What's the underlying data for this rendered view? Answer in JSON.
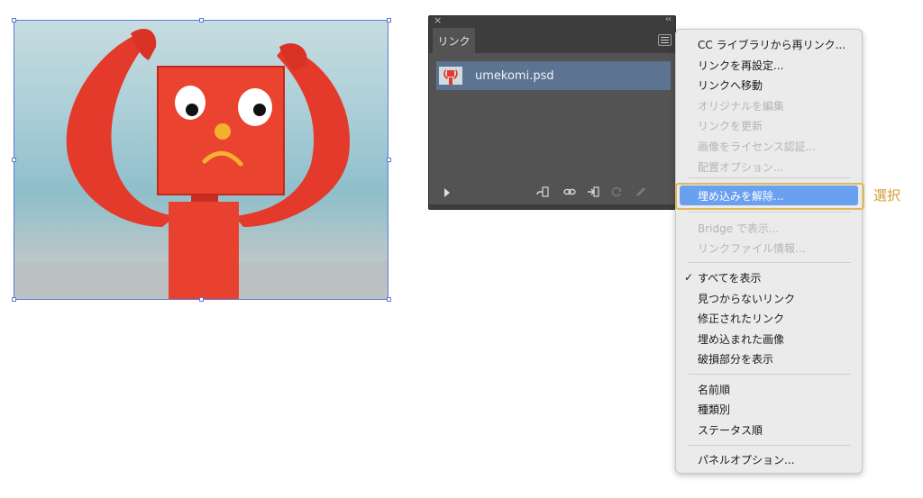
{
  "canvas": {
    "image_description_icon": "robot-figure-image"
  },
  "panel": {
    "close_glyph": "×",
    "collapse_glyph": "‹‹",
    "tab_label": "リンク",
    "links": [
      {
        "name": "umekomi.psd"
      }
    ],
    "bottom_icons": [
      "expand-arrow-icon",
      "relink-from-cc-icon",
      "relink-icon",
      "goto-link-icon",
      "update-link-icon",
      "edit-original-icon"
    ]
  },
  "menu": {
    "items": [
      {
        "label": "CC ライブラリから再リンク...",
        "disabled": false
      },
      {
        "label": "リンクを再設定...",
        "disabled": false
      },
      {
        "label": "リンクへ移動",
        "disabled": false
      },
      {
        "label": "オリジナルを編集",
        "disabled": true
      },
      {
        "label": "リンクを更新",
        "disabled": true
      },
      {
        "label": "画像をライセンス認証...",
        "disabled": true
      },
      {
        "label": "配置オプション...",
        "disabled": true
      },
      {
        "label": "埋め込みを解除...",
        "disabled": false,
        "highlighted": true
      },
      {
        "label": "Bridge で表示...",
        "disabled": true
      },
      {
        "label": "リンクファイル情報...",
        "disabled": true
      },
      {
        "label": "すべてを表示",
        "disabled": false,
        "checked": true
      },
      {
        "label": "見つからないリンク",
        "disabled": false
      },
      {
        "label": "修正されたリンク",
        "disabled": false
      },
      {
        "label": "埋め込まれた画像",
        "disabled": false
      },
      {
        "label": "破損部分を表示",
        "disabled": false
      },
      {
        "label": "名前順",
        "disabled": false
      },
      {
        "label": "種類別",
        "disabled": false
      },
      {
        "label": "ステータス順",
        "disabled": false
      },
      {
        "label": "パネルオプション...",
        "disabled": false
      }
    ],
    "check_glyph": "✓"
  },
  "callout": {
    "label": "選択"
  },
  "colors": {
    "highlight": "#6aa0f0",
    "callout": "#e0b85a",
    "panel_bg": "#535353",
    "selection": "#5b7bd6"
  }
}
